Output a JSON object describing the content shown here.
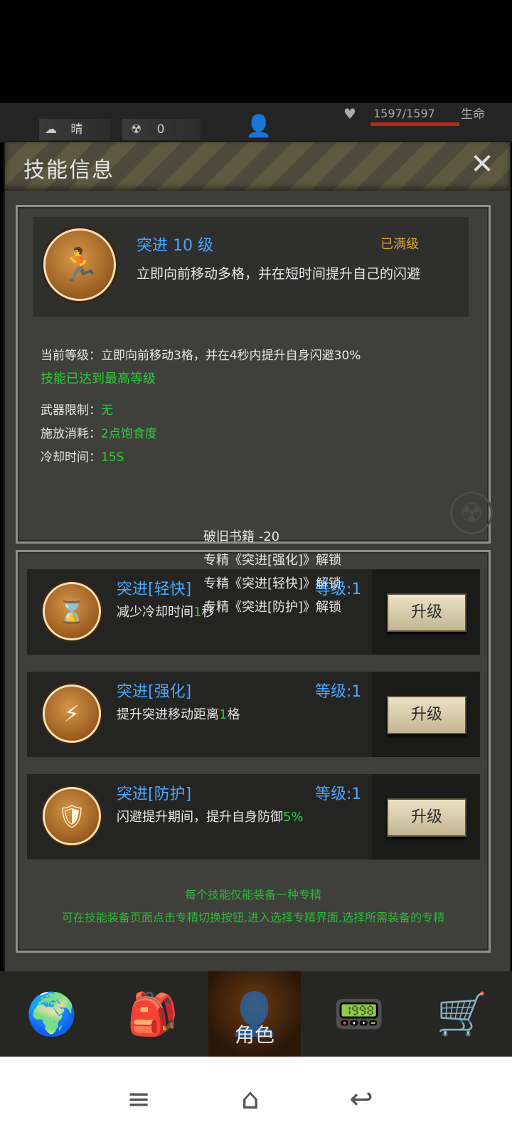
{
  "status": {
    "weather_label": "晴",
    "radiation_value": "0",
    "hp_text": "1597/1597",
    "hp_label": "生命",
    "hp_fraction": 1.0
  },
  "dialog": {
    "title": "技能信息",
    "close_symbol": "✕"
  },
  "skill": {
    "name": "突进 10 级",
    "max_label": "已满级",
    "description": "立即向前移动多格，并在短时间提升自己的闪避",
    "current_level_label": "当前等级：",
    "current_level_text": "立即向前移动3格，并在4秒内提升自身闪避30%",
    "max_reached": "技能已达到最高等级",
    "weapon_label": "武器限制：",
    "weapon_value": "无",
    "cost_label": "施放消耗：",
    "cost_value": "2点饱食度",
    "cooldown_label": "冷却时间：",
    "cooldown_value": "15S"
  },
  "specs": [
    {
      "name": "突进[轻快]",
      "level": "等级:1",
      "desc": "减少冷却时间",
      "value": "1",
      "unit": "秒",
      "button": "升级",
      "icon": "runner-hourglass-icon"
    },
    {
      "name": "突进[强化]",
      "level": "等级:1",
      "desc": "提升突进移动距离",
      "value": "1",
      "unit": "格",
      "button": "升级",
      "icon": "runner-lightning-icon"
    },
    {
      "name": "突进[防护]",
      "level": "等级:1",
      "desc": "闪避提升期间，提升自身防御",
      "value": "5%",
      "unit": "",
      "button": "升级",
      "icon": "runner-shield-icon"
    }
  ],
  "tooltip": [
    "破旧书籍 -20",
    "专精《突进[强化]》解锁",
    "专精《突进[轻快]》解锁",
    "专精《突进[防护]》解锁"
  ],
  "notes": [
    "每个技能仅能装备一种专精",
    "可在技能装备页面点击专精切换按钮,进入选择专精界面,选择所需装备的专精"
  ],
  "nav": {
    "character_label": "角色",
    "items": [
      "globe-icon",
      "backpack-icon",
      "character-icon",
      "radio-icon",
      "cart-icon"
    ]
  }
}
